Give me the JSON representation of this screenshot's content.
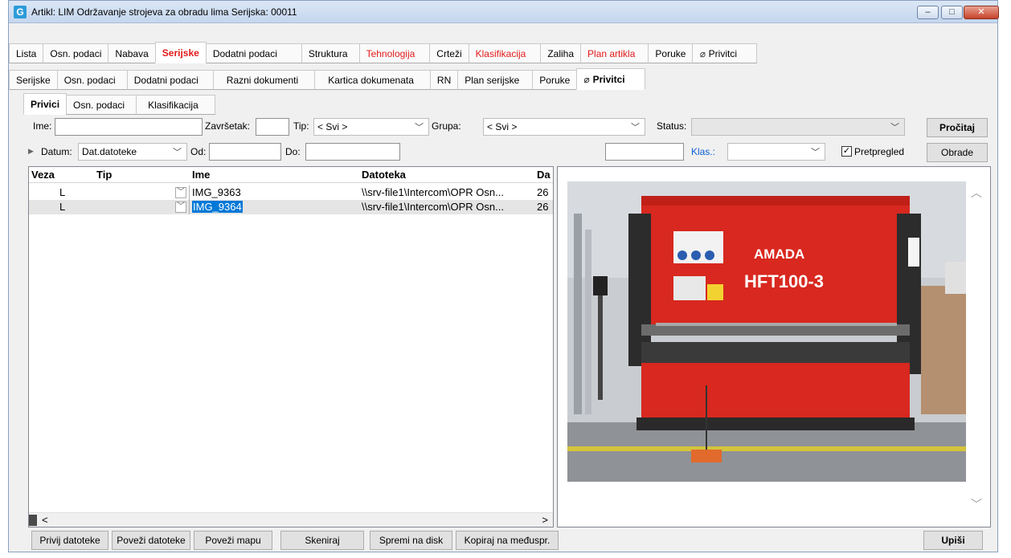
{
  "window": {
    "title": "Artikl: LIM Održavanje strojeva za obradu lima Serijska:  00011",
    "icon_letter": "G",
    "minimize": "–",
    "maximize": "□",
    "close": "✕"
  },
  "tabs_main": [
    {
      "label": "Lista",
      "red": false
    },
    {
      "label": "Osn. podaci",
      "red": false
    },
    {
      "label": "Nabava",
      "red": false
    },
    {
      "label": "Serijske",
      "red": true,
      "active": true
    },
    {
      "label": "Dodatni podaci",
      "red": false
    },
    {
      "label": "Struktura",
      "red": false
    },
    {
      "label": "Tehnologija",
      "red": true
    },
    {
      "label": "Crteži",
      "red": false
    },
    {
      "label": "Klasifikacija",
      "red": true
    },
    {
      "label": "Zaliha",
      "red": false
    },
    {
      "label": "Plan artikla",
      "red": true
    },
    {
      "label": "Poruke",
      "red": false
    },
    {
      "label": "Privitci",
      "red": false
    }
  ],
  "tabs_sub": [
    {
      "label": "Serijske"
    },
    {
      "label": "Osn. podaci"
    },
    {
      "label": "Dodatni podaci"
    },
    {
      "label": "Razni dokumenti"
    },
    {
      "label": "Kartica dokumenata"
    },
    {
      "label": "RN"
    },
    {
      "label": "Plan serijske"
    },
    {
      "label": "Poruke"
    },
    {
      "label": "Privitci",
      "active": true
    }
  ],
  "tabs_inner": [
    {
      "label": "Privici",
      "active": true
    },
    {
      "label": "Osn. podaci"
    },
    {
      "label": "Klasifikacija"
    }
  ],
  "filters": {
    "ime_label": "Ime:",
    "zavrsetak_label": "Završetak:",
    "tip_label": "Tip:",
    "tip_value": "< Svi >",
    "grupa_label": "Grupa:",
    "grupa_value": "< Svi >",
    "status_label": "Status:",
    "status_value": "",
    "procitaj": "Pročitaj",
    "datum_label": "Datum:",
    "datum_value": "Dat.datoteke",
    "od_label": "Od:",
    "do_label": "Do:",
    "klas_label": "Klas.:",
    "pretpregled_label": "Pretpregled",
    "pretpregled_checked": "✓",
    "obrade": "Obrade"
  },
  "grid": {
    "columns": [
      "Veza",
      "Tip",
      "Ime",
      "Datoteka",
      "Da"
    ],
    "rows": [
      {
        "veza": "L",
        "ime": "IMG_9363",
        "datoteka": "\\\\srv-file1\\Intercom\\OPR Osn...",
        "da": "26"
      },
      {
        "veza": "L",
        "ime": "IMG_9364",
        "datoteka": "\\\\srv-file1\\Intercom\\OPR Osn...",
        "da": "26"
      }
    ],
    "scroll_left": "<",
    "scroll_right": ">"
  },
  "preview": {
    "machine_brand": "AMADA",
    "machine_model": "HFT100-3",
    "scroll_up": "︿",
    "scroll_down": "﹀"
  },
  "bottom_buttons": {
    "privij": "Privij datoteke",
    "povezi_datoteke": "Poveži datoteke",
    "povezi_mapu": "Poveži mapu",
    "skeniraj": "Skeniraj",
    "spremi": "Spremi na disk",
    "kopiraj": "Kopiraj na međuspr.",
    "upisi": "Upiši"
  },
  "colors": {
    "accent_red": "#e21a1a",
    "selection_blue": "#0078d7",
    "machine_red": "#d8281f"
  }
}
